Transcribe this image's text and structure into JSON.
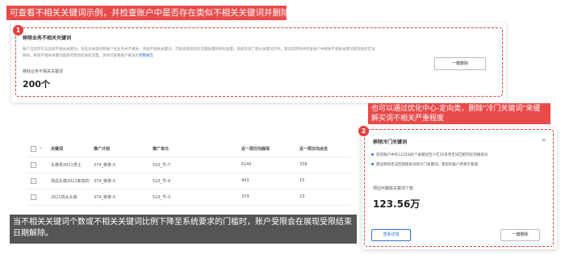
{
  "top_banner": "可查看不相关关键词示例，并检查账户中是否存在类似不相关关键词并删除",
  "card1": {
    "badge": "1",
    "title": "移除业务不相关关键词",
    "desc_line1": "账户当前存在与品牌不相关关键词，有些多关键词和账户名业务并不相关，添加不相关关键词，可能会影响您的流量质量和转化质量。系统检测了部分关键词示例，建议您移除并检查账户中相关不相关关键词或添加否定词",
    "desc_line2": "移除。移除不相关关键词能获得更加优质的流量。具体可查看账户概况页",
    "desc_link": "完整报告",
    "sub_label": "移除业务不相关关键词",
    "count": "200个",
    "button": "一键删除"
  },
  "right_banner": "也可以通过优化中心-定向类，删除\"冷门关键词\"来缓解买词不相关严重程度",
  "table": {
    "headers": [
      "关键词",
      "推广计划",
      "推广单元",
      "近一周日均展现",
      "近一周日均点击"
    ],
    "rows": [
      [
        "头像男2021男士",
        "374_荣誉-0",
        "510_节-7",
        "6245",
        "338"
      ],
      [
        "情侣头像2021新款的",
        "374_荣誉-0",
        "510_节-4",
        "493",
        "15"
      ],
      [
        "2021情头头像",
        "374_荣誉-0",
        "510_节-3",
        "374",
        "23"
      ]
    ]
  },
  "card2": {
    "badge": "2",
    "title": "移除冷门关键词",
    "close": "×",
    "bullet1": "您的账户中有1235586个关键词至少在30日内无法匹配到任何搜索词",
    "bullet2": "建议移除无法匹配搜索词的冷门关键词，使您的账户更易于管理",
    "sub_label": "预估可删除关键词个数",
    "value": "123.56万",
    "btn_left": "查看详情",
    "btn_right": "一键删除"
  },
  "caption": "当不相关关键词个数或不相关关键词比例下降至系统要求的门槛时，账户受限会在展现受限结束日期解除。",
  "colors": {
    "accent_red": "#e94a4a",
    "link_blue": "#2f6fde"
  }
}
